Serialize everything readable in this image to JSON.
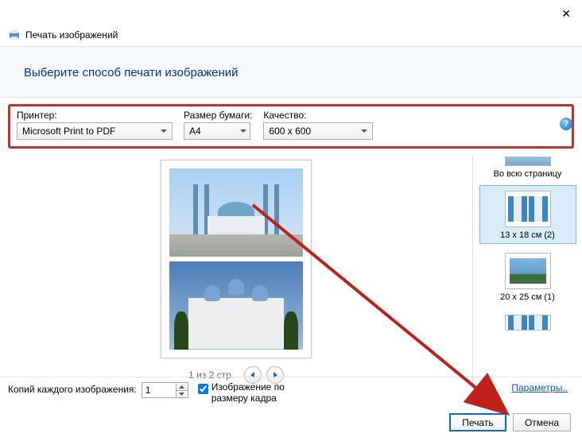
{
  "window": {
    "title": "Печать изображений"
  },
  "headline": "Выберите способ печати изображений",
  "fields": {
    "printer": {
      "label": "Принтер:",
      "value": "Microsoft Print to PDF"
    },
    "paper": {
      "label": "Размер бумаги:",
      "value": "A4"
    },
    "quality": {
      "label": "Качество:",
      "value": "600 x 600"
    }
  },
  "pager": {
    "text": "1 из 2 стр"
  },
  "sidebar": {
    "full_label": "Во всю страницу",
    "layouts": [
      {
        "label": "13 x 18 см (2)",
        "selected": true
      },
      {
        "label": "20 x 25 см (1)",
        "selected": false
      }
    ]
  },
  "params_link": "Параметры..",
  "copies": {
    "label": "Копий каждого изображения:",
    "value": "1"
  },
  "fit": {
    "label": "Изображение по размеру кадра",
    "checked": true
  },
  "buttons": {
    "print": "Печать",
    "cancel": "Отмена"
  }
}
